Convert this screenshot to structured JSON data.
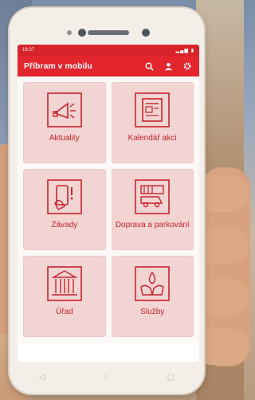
{
  "status_bar": {
    "time": "19:37",
    "icons": "▂▄▆ ▮"
  },
  "app_bar": {
    "title": "Příbram v mobilu",
    "icons": [
      "search-icon",
      "user-icon",
      "gear-icon"
    ]
  },
  "tiles": [
    {
      "label": "Aktuality",
      "icon": "megaphone-icon"
    },
    {
      "label": "Kalendář akcí",
      "icon": "calendar-icon"
    },
    {
      "label": "Závady",
      "icon": "phone-report-icon"
    },
    {
      "label": "Doprava a parkování",
      "icon": "bus-parking-icon"
    },
    {
      "label": "Úřad",
      "icon": "town-hall-icon"
    },
    {
      "label": "Služby",
      "icon": "hands-drop-icon"
    }
  ],
  "nav_buttons": {
    "back": "◁",
    "home": "○",
    "recent": "▢"
  },
  "colors": {
    "accent": "#e3252d",
    "tile_bg": "#f2d4d3",
    "tile_text": "#c8232b"
  }
}
